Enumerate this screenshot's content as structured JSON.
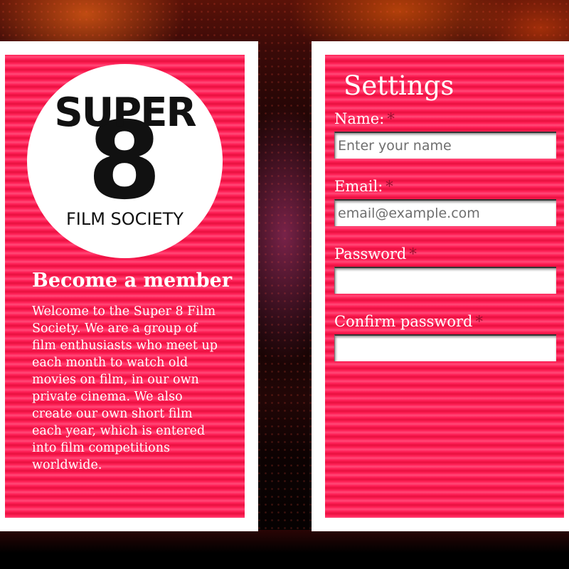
{
  "logo": {
    "top_text": "SUPER",
    "numeral": "8",
    "bottom_text": "FILM SOCIETY"
  },
  "membership": {
    "heading": "Become a member",
    "description": "Welcome to the Super 8 Film Society. We are a group of film enthusiasts who meet up each month to watch old movies on film, in our own private cinema. We also create our own short film each year, which is entered into film competitions worldwide."
  },
  "settings": {
    "title": "Settings",
    "required_marker": "*",
    "fields": [
      {
        "label": "Name:",
        "placeholder": "Enter your name",
        "value": ""
      },
      {
        "label": "Email:",
        "placeholder": "email@example.com",
        "value": ""
      },
      {
        "label": "Password",
        "placeholder": "",
        "value": ""
      },
      {
        "label": "Confirm password",
        "placeholder": "",
        "value": ""
      }
    ]
  },
  "colors": {
    "panel_pink": "#ff1d4f",
    "panel_border": "#ffffff",
    "required_marker": "#9a1230"
  }
}
